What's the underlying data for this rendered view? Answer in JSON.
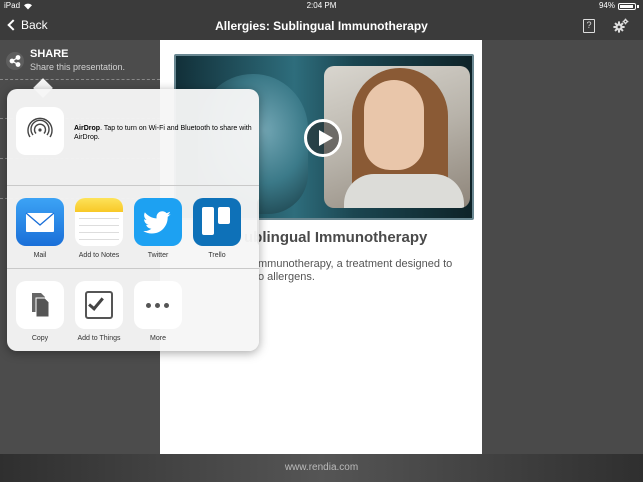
{
  "status_bar": {
    "device": "iPad",
    "time": "2:04 PM",
    "battery": "94%",
    "battery_level": 0.94
  },
  "nav": {
    "back_label": "Back",
    "title": "Allergies: Sublingual Immunotherapy",
    "help_label": "?"
  },
  "sidebar": {
    "share_title": "SHARE",
    "share_subtitle": "Share this presentation."
  },
  "content": {
    "title_visible": "ublingual Immunotherapy",
    "desc_line1": "mmunotherapy, a treatment designed to",
    "desc_line2": "o allergens."
  },
  "share_sheet": {
    "airdrop_bold": "AirDrop",
    "airdrop_text": ". Tap to turn on Wi-Fi and Bluetooth to share with AirDrop.",
    "apps": [
      {
        "label": "Mail",
        "icon": "mail-icon"
      },
      {
        "label": "Add to Notes",
        "icon": "notes-icon"
      },
      {
        "label": "Twitter",
        "icon": "twitter-icon"
      },
      {
        "label": "Trello",
        "icon": "trello-icon"
      }
    ],
    "actions": [
      {
        "label": "Copy",
        "icon": "copy-icon"
      },
      {
        "label": "Add to Things",
        "icon": "checkbox-icon"
      },
      {
        "label": "More",
        "icon": "more-icon"
      }
    ]
  },
  "footer": {
    "url": "www.rendia.com"
  },
  "colors": {
    "bar_bg": "#3b3b3b",
    "sidebar_bg": "#4c4c4c",
    "popover_bg": "#f6f6f6",
    "mail_blue": "#1a6fd8",
    "twitter_blue": "#1da1f2",
    "trello_blue": "#0e71b8"
  }
}
